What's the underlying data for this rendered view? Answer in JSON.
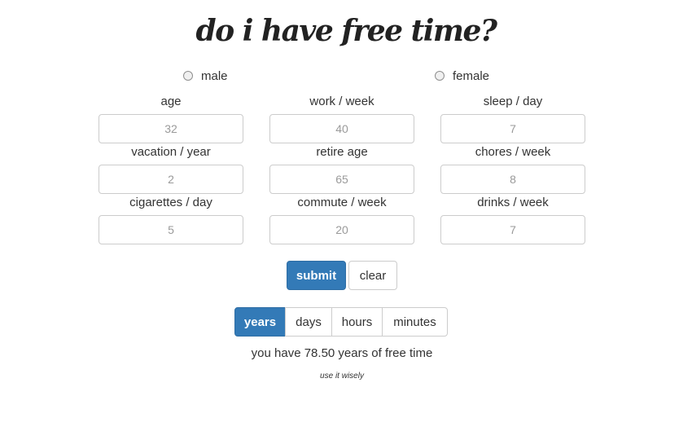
{
  "title": "do i have free time?",
  "gender": {
    "options": [
      "male",
      "female"
    ]
  },
  "fields": [
    {
      "label": "age",
      "placeholder": "32"
    },
    {
      "label": "work / week",
      "placeholder": "40"
    },
    {
      "label": "sleep / day",
      "placeholder": "7"
    },
    {
      "label": "vacation / year",
      "placeholder": "2"
    },
    {
      "label": "retire age",
      "placeholder": "65"
    },
    {
      "label": "chores / week",
      "placeholder": "8"
    },
    {
      "label": "cigarettes / day",
      "placeholder": "5"
    },
    {
      "label": "commute / week",
      "placeholder": "20"
    },
    {
      "label": "drinks / week",
      "placeholder": "7"
    }
  ],
  "actions": {
    "submit": "submit",
    "clear": "clear"
  },
  "units": {
    "options": [
      "years",
      "days",
      "hours",
      "minutes"
    ],
    "selected": "years"
  },
  "result": {
    "text": "you have 78.50 years of free time",
    "subtext": "use it wisely"
  },
  "colors": {
    "primary": "#337ab7"
  }
}
